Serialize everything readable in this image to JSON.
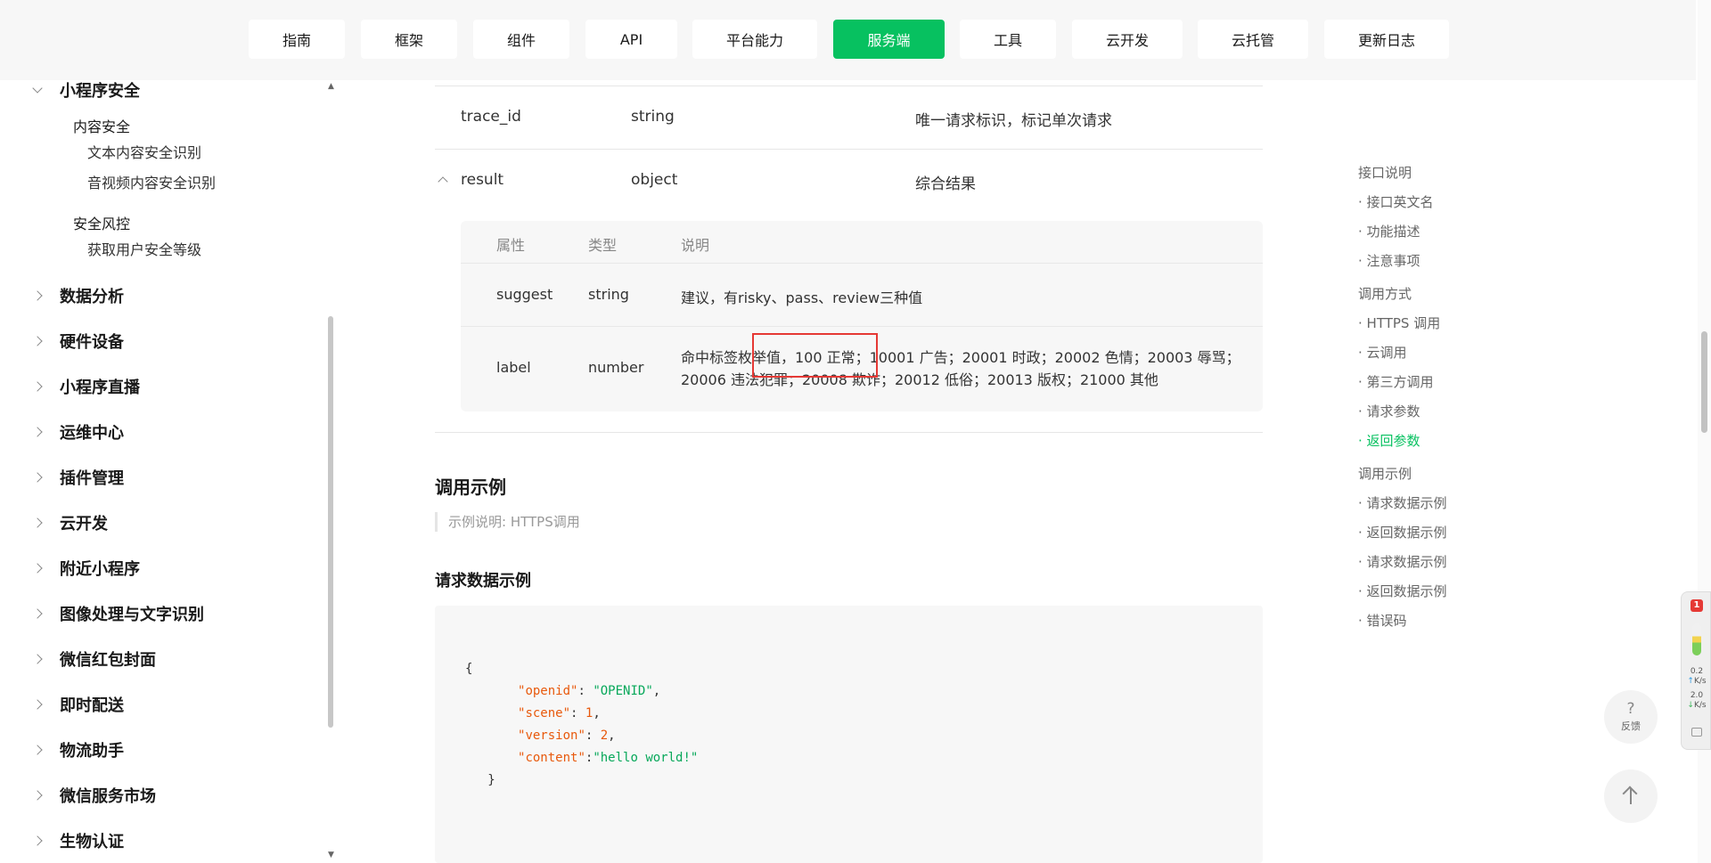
{
  "topnav": {
    "tabs": [
      {
        "label": "指南"
      },
      {
        "label": "框架"
      },
      {
        "label": "组件"
      },
      {
        "label": "API"
      },
      {
        "label": "平台能力"
      },
      {
        "label": "服务端",
        "active": true
      },
      {
        "label": "工具"
      },
      {
        "label": "云开发"
      },
      {
        "label": "云托管"
      },
      {
        "label": "更新日志"
      }
    ]
  },
  "sidebar": {
    "expanded_section": "小程序安全",
    "groups": [
      {
        "title": "内容安全",
        "items": [
          "文本内容安全识别",
          "音视频内容安全识别"
        ]
      },
      {
        "title": "安全风控",
        "items": [
          "获取用户安全等级"
        ]
      }
    ],
    "collapsed": [
      "数据分析",
      "硬件设备",
      "小程序直播",
      "运维中心",
      "插件管理",
      "云开发",
      "附近小程序",
      "图像处理与文字识别",
      "微信红包封面",
      "即时配送",
      "物流助手",
      "微信服务市场",
      "生物认证"
    ]
  },
  "table": {
    "rows": [
      {
        "name": "trace_id",
        "type": "string",
        "desc": "唯一请求标识，标记单次请求"
      },
      {
        "name": "result",
        "type": "object",
        "desc": "综合结果"
      }
    ],
    "sub": {
      "headers": [
        "属性",
        "类型",
        "说明"
      ],
      "rows": [
        {
          "name": "suggest",
          "type": "string",
          "desc": "建议，有risky、pass、review三种值"
        },
        {
          "name": "label",
          "type": "number",
          "desc": "命中标签枚举值，100 正常；10001 广告；20001 时政；20002 色情；20003 辱骂；20006 违法犯罪；20008 欺诈；20012 低俗；20013 版权；21000 其他"
        }
      ]
    }
  },
  "example": {
    "heading": "调用示例",
    "note": "示例说明: HTTPS调用",
    "request_heading": "请求数据示例",
    "code": {
      "open": "{",
      "lines": [
        {
          "key": "\"openid\"",
          "sep": ": ",
          "val": "\"OPENID\"",
          "type": "string",
          "end": ","
        },
        {
          "key": "\"scene\"",
          "sep": ": ",
          "val": "1",
          "type": "number",
          "end": ","
        },
        {
          "key": "\"version\"",
          "sep": ": ",
          "val": "2",
          "type": "number",
          "end": ","
        },
        {
          "key": "\"content\"",
          "sep": ":",
          "val": "\"hello world!\"",
          "type": "string",
          "end": ""
        }
      ],
      "close": "}"
    }
  },
  "toc": {
    "items": [
      {
        "label": "接口说明",
        "level": 1
      },
      {
        "label": "· 接口英文名",
        "level": 2
      },
      {
        "label": "· 功能描述",
        "level": 2
      },
      {
        "label": "· 注意事项",
        "level": 2
      },
      {
        "label": "调用方式",
        "level": 1
      },
      {
        "label": "· HTTPS 调用",
        "level": 2
      },
      {
        "label": "· 云调用",
        "level": 2
      },
      {
        "label": "· 第三方调用",
        "level": 2
      },
      {
        "label": "· 请求参数",
        "level": 2
      },
      {
        "label": "· 返回参数",
        "level": 2,
        "active": true
      },
      {
        "label": "调用示例",
        "level": 1
      },
      {
        "label": "· 请求数据示例",
        "level": 2
      },
      {
        "label": "· 返回数据示例",
        "level": 2
      },
      {
        "label": "· 请求数据示例",
        "level": 2
      },
      {
        "label": "· 返回数据示例",
        "level": 2
      },
      {
        "label": "· 错误码",
        "level": 2
      }
    ]
  },
  "widget": {
    "badge": "1",
    "up_speed": "0.2",
    "up_unit": "K/s",
    "down_speed": "2.0",
    "down_unit": "K/s"
  },
  "feedback": {
    "icon": "?",
    "label": "反馈"
  },
  "colors": {
    "accent": "#07c160",
    "highlight": "#e53935",
    "code_key": "#e8590c",
    "code_string": "#07a85a"
  }
}
